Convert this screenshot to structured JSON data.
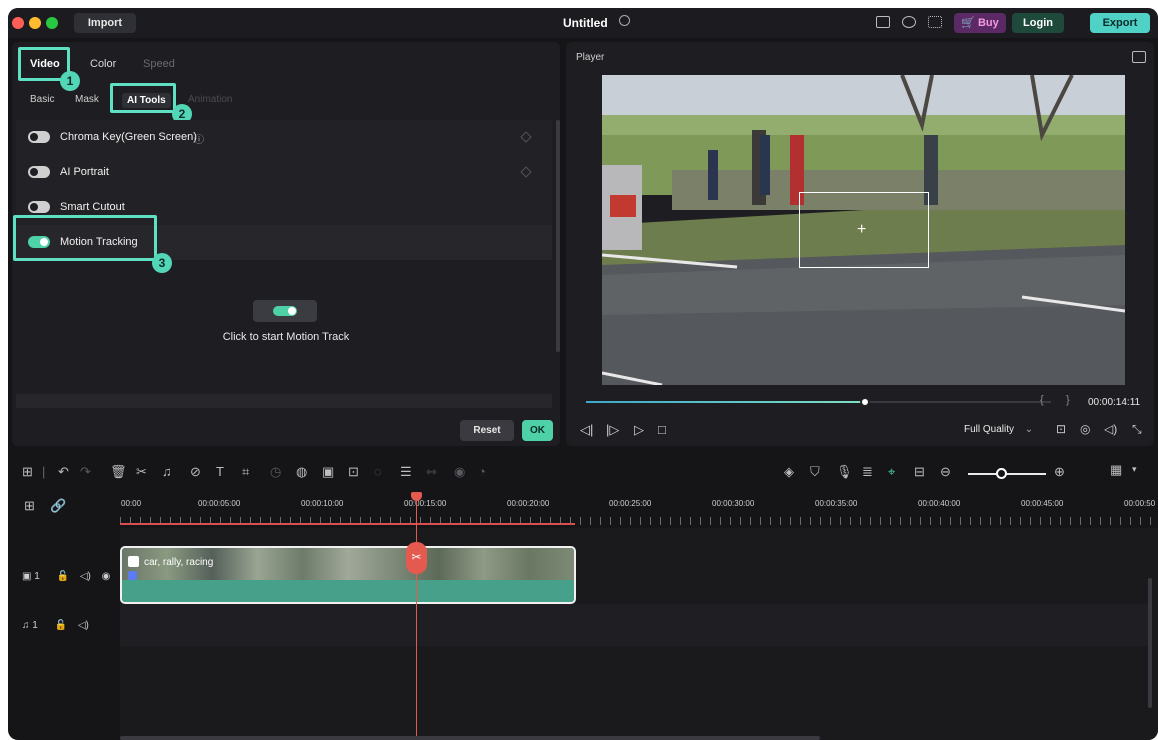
{
  "titlebar": {
    "import_label": "Import",
    "title": "Untitled",
    "buy_label": "Buy",
    "login_label": "Login",
    "export_label": "Export"
  },
  "left_panel": {
    "tabs": [
      "Video",
      "Color",
      "Speed"
    ],
    "subtabs": [
      "Basic",
      "Mask",
      "AI Tools",
      "Animation"
    ],
    "tools": [
      {
        "label": "Chroma Key(Green Screen)",
        "enabled": false
      },
      {
        "label": "AI Portrait",
        "enabled": false
      },
      {
        "label": "Smart Cutout",
        "enabled": false
      },
      {
        "label": "Motion Tracking",
        "enabled": true
      }
    ],
    "motion_caption": "Click to start Motion Track",
    "reset_label": "Reset",
    "ok_label": "OK",
    "callouts": [
      "1",
      "2",
      "3"
    ]
  },
  "player": {
    "label": "Player",
    "timecode": "00:00:14:11",
    "quality": "Full Quality",
    "progress": 0.6
  },
  "timeline": {
    "ruler": [
      "00:00",
      "00:00:05:00",
      "00:00:10:00",
      "00:00:15:00",
      "00:00:20:00",
      "00:00:25:00",
      "00:00:30:00",
      "00:00:35:00",
      "00:00:40:00",
      "00:00:45:00",
      "00:00:50"
    ],
    "clip_label": "car, rally, racing",
    "video_track": "1",
    "audio_track": "1"
  },
  "colors": {
    "accent": "#4fd1a8",
    "callout": "#5fe0c3",
    "playhead": "#e55a4f",
    "buy": "#f39ae0"
  }
}
